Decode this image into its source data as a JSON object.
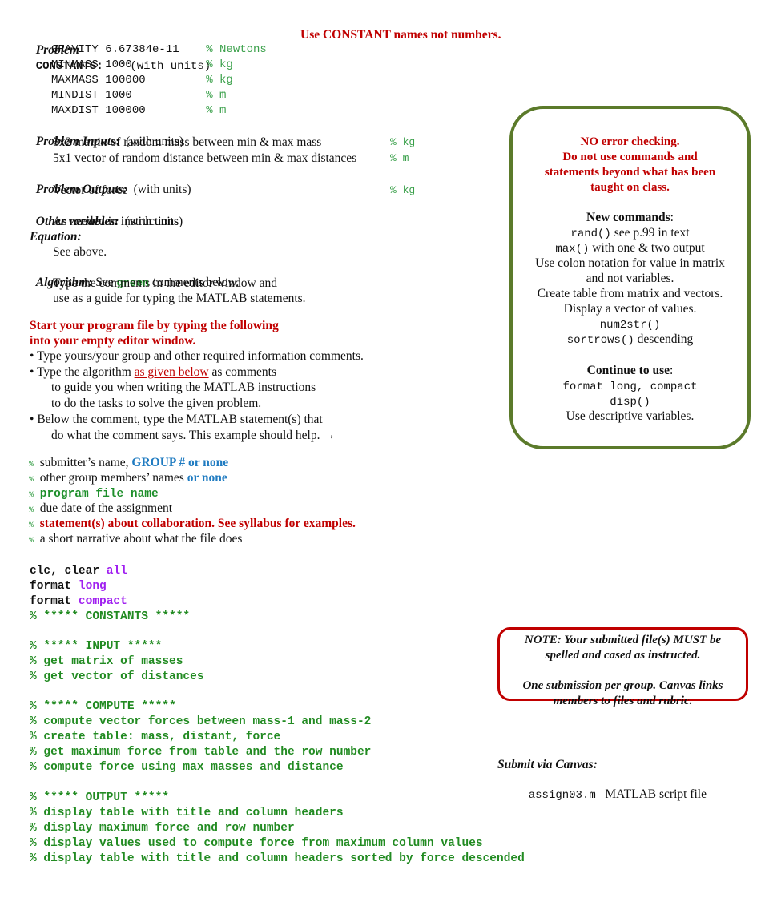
{
  "constants": {
    "label_italic": "Problem",
    "label_mono": "CONSTANTS:",
    "units_note": "(with units)",
    "warning": "Use CONSTANT names not numbers.",
    "items": [
      {
        "name": "GRAVITY",
        "value": "6.67384e-11",
        "unit": "% Newtons"
      },
      {
        "name": "MINMASS",
        "value": "1000",
        "unit": "% kg"
      },
      {
        "name": "MAXMASS",
        "value": "100000",
        "unit": "% kg"
      },
      {
        "name": "MINDIST",
        "value": "1000",
        "unit": "% m"
      },
      {
        "name": "MAXDIST",
        "value": "100000",
        "unit": "% m"
      }
    ]
  },
  "inputs": {
    "label": "Problem Inputs",
    "colon": ":",
    "units_note": "(with units)",
    "items": [
      {
        "text": "5x2 matrix of random mass between min & max mass",
        "unit": "% kg"
      },
      {
        "text": "5x1 vector of random distance between min & max distances",
        "unit": "% m"
      }
    ]
  },
  "outputs": {
    "label": "Problem Outputs:",
    "units_note": "(with units)",
    "items": [
      {
        "text": "Vector of force",
        "unit": "% kg"
      }
    ]
  },
  "other_vars": {
    "label": "Other variables:",
    "units_note": "(with units)",
    "text": "As needed in instructions"
  },
  "equation": {
    "label": "Equation:",
    "text": "See above."
  },
  "algorithm": {
    "label": "Algorithm:",
    "see": "See",
    "green_word": "green",
    "rest": "comments below.",
    "lines": [
      "Type the comments in the editor window and",
      "use as a guide for typing the MATLAB statements."
    ]
  },
  "start": {
    "lines": [
      "Start your program file by typing the following",
      "into your empty editor window."
    ],
    "bullets": [
      {
        "lines": [
          "Type yours/your group and other required information comments."
        ]
      },
      {
        "pre": "Type the algorithm",
        "link": "as given below",
        "post": "as comments",
        "lines": [
          "to guide you when writing the MATLAB instructions",
          "to do the tasks to solve the given problem."
        ]
      },
      {
        "lines": [
          "Below the comment, type the MATLAB statement(s) that",
          "do what the comment says. This example should help. →"
        ]
      }
    ]
  },
  "header_comments": [
    {
      "pct": "%",
      "plain": "submitter’s name,",
      "accent": "GROUP # or none",
      "style": "blue"
    },
    {
      "pct": "%",
      "plain": "other group members’ names",
      "accent": "or none",
      "style": "blue"
    },
    {
      "pct": "%",
      "plain": "",
      "accent": "program file name",
      "style": "green-mono"
    },
    {
      "pct": "%",
      "plain": "due date of the assignment",
      "accent": "",
      "style": "none"
    },
    {
      "pct": "%",
      "plain": "",
      "accent": "statement(s) about collaboration. See syllabus for examples.",
      "style": "red"
    },
    {
      "pct": "%",
      "plain": "a short narrative about what the file does",
      "accent": "",
      "style": "none"
    }
  ],
  "code": {
    "setup": [
      {
        "kw": "clc, clear",
        "arg": "all"
      },
      {
        "kw": "format",
        "arg": "long"
      },
      {
        "kw": "format",
        "arg": "compact"
      }
    ],
    "constants_header": "% ***** CONSTANTS *****",
    "input_block": [
      "% ***** INPUT *****",
      "% get matrix of masses",
      "% get vector of distances"
    ],
    "compute_block": [
      "% ***** COMPUTE *****",
      "% compute vector forces between mass-1 and mass-2",
      "% create table: mass, distant, force",
      "% get maximum force from table and the row number",
      "% compute force using max masses and distance"
    ],
    "output_block": [
      "% ***** OUTPUT *****",
      "% display table with title and column headers",
      "% display maximum force and row number",
      "% display values used to compute force from maximum column values",
      "% display table with title and column headers sorted by force descended"
    ]
  },
  "rules_box": {
    "warning_lines": [
      "NO error checking.",
      "Do not use commands and",
      "statements beyond what has been",
      "taught on class."
    ],
    "new_label": "New commands",
    "new_items": [
      {
        "mono": "rand()",
        "text": " see p.99 in text"
      },
      {
        "mono": "max()",
        "text": " with one & two output"
      },
      {
        "mono": "",
        "text": "Use colon notation for value in matrix"
      },
      {
        "mono": "",
        "text": "and not variables."
      },
      {
        "mono": "",
        "text": "Create table from matrix and vectors."
      },
      {
        "mono": "",
        "text": "Display a vector of values."
      },
      {
        "mono": "num2str()",
        "text": ""
      },
      {
        "mono": "sortrows()",
        "text": " descending"
      }
    ],
    "continue_label": "Continue to use",
    "continue_items": [
      {
        "mono": "format long, compact",
        "text": ""
      },
      {
        "mono": "disp()",
        "text": ""
      },
      {
        "mono": "",
        "text": "Use descriptive variables."
      }
    ]
  },
  "note_box": {
    "lines1": [
      "NOTE: Your submitted file(s) MUST be",
      "spelled and cased as instructed."
    ],
    "lines2": [
      "One submission per group. Canvas links",
      "members to files and rubric."
    ]
  },
  "submit": {
    "label": "Submit via Canvas:",
    "file": "assign03.m",
    "desc": "MATLAB script file"
  }
}
